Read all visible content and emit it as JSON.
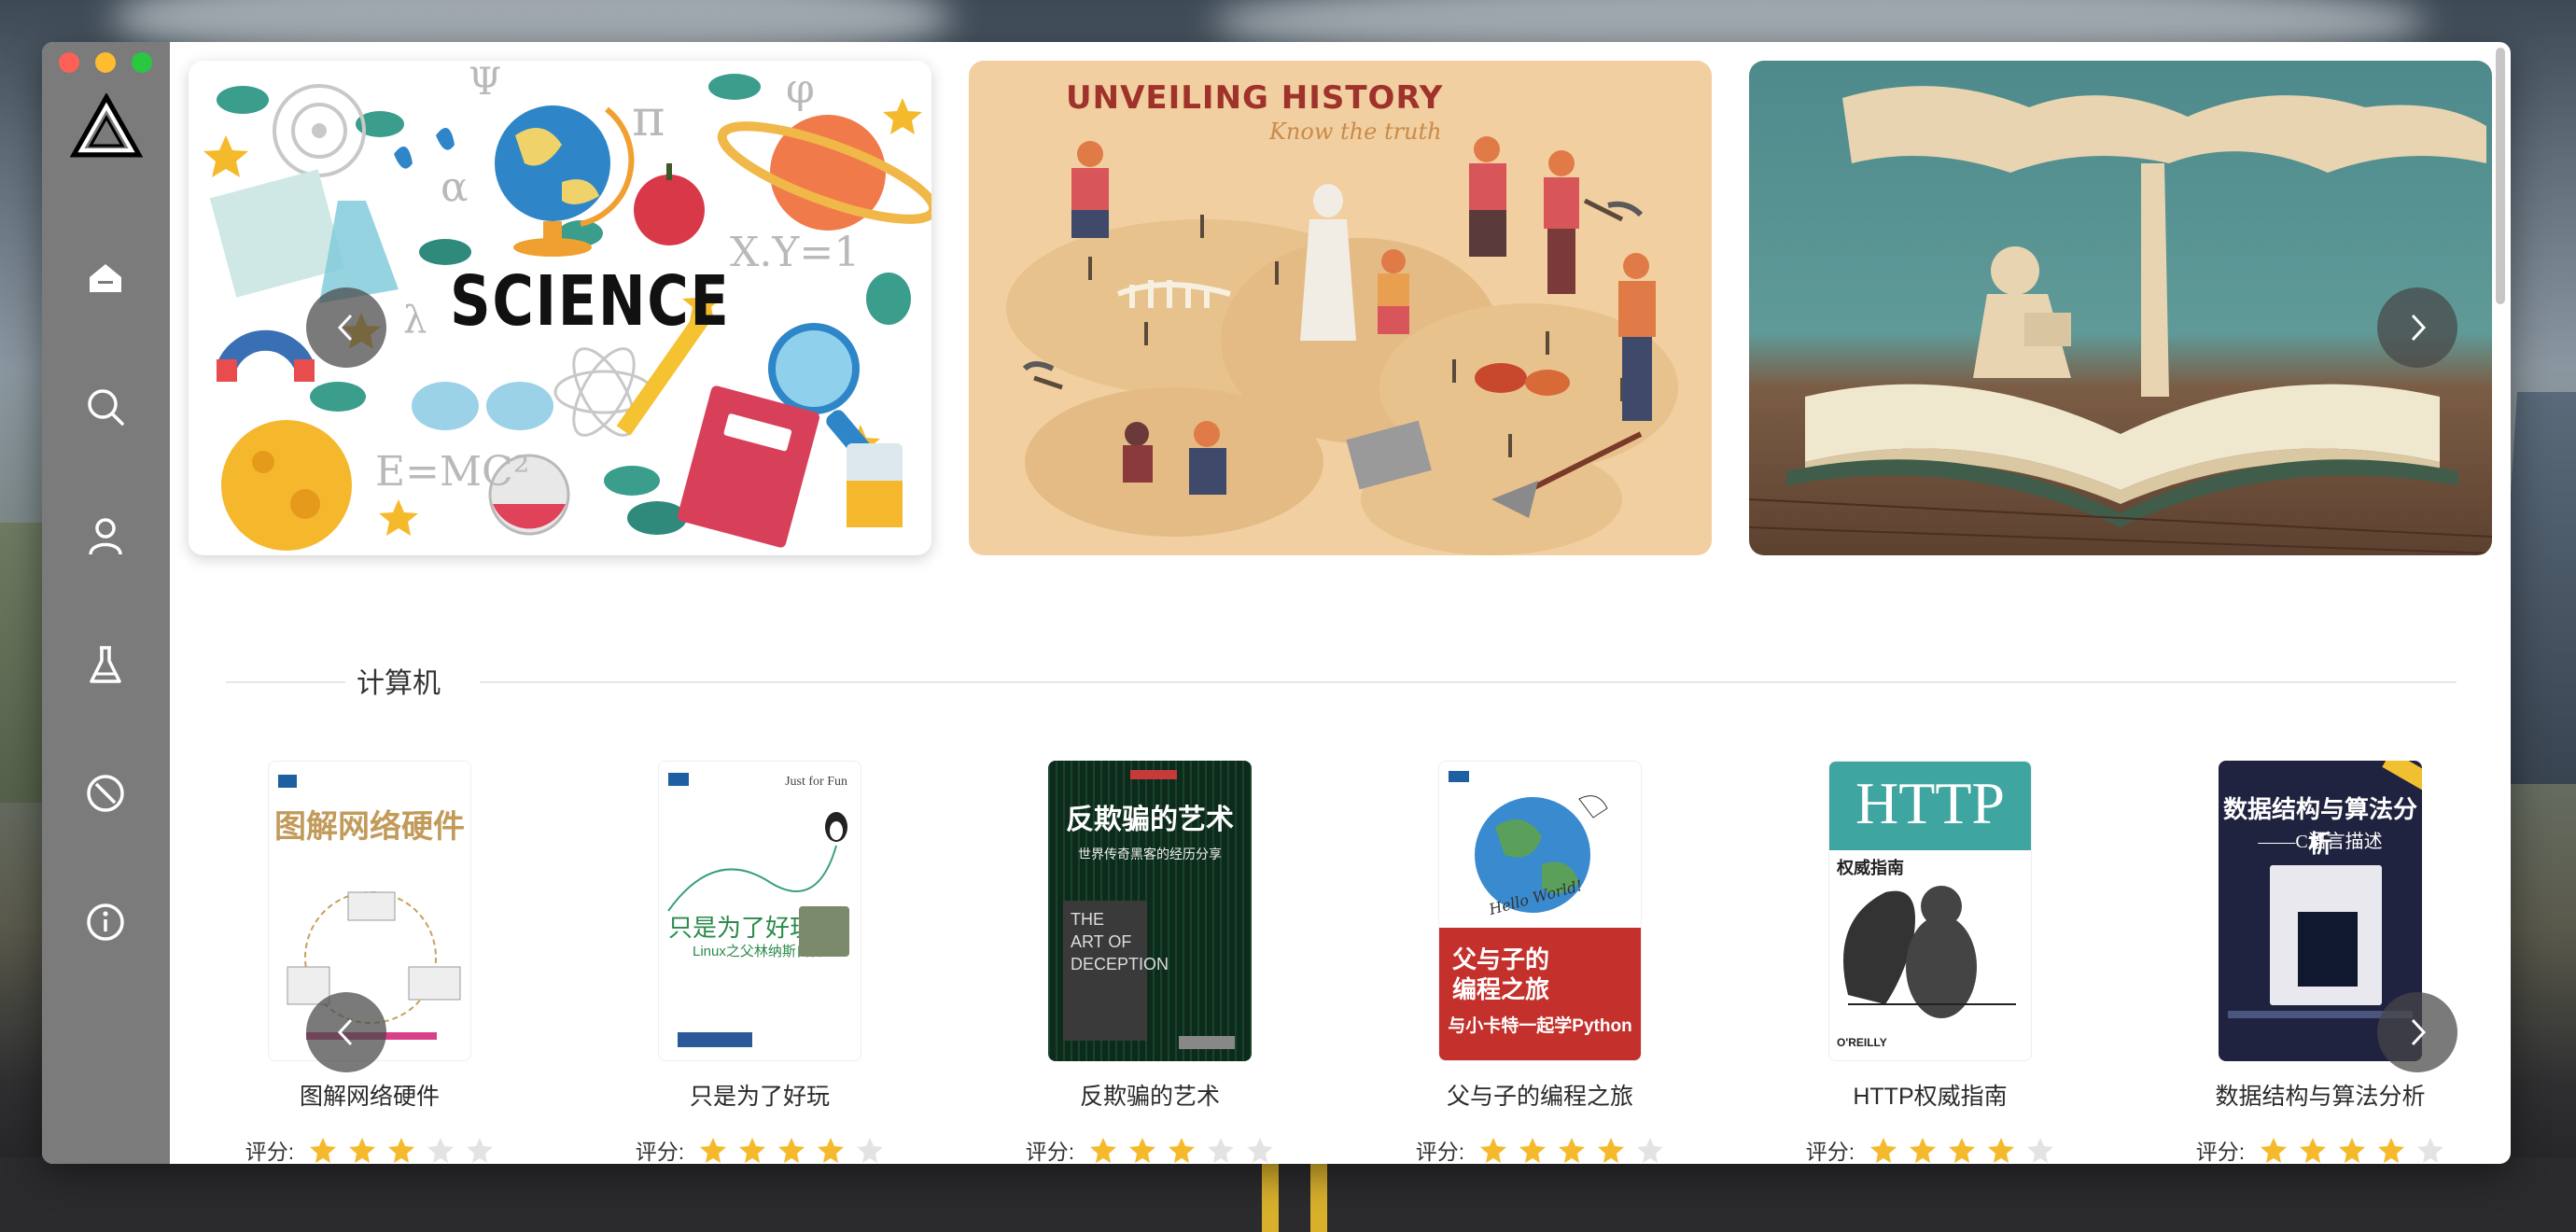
{
  "window": {
    "controls": [
      "close",
      "minimize",
      "maximize"
    ]
  },
  "sidebar": {
    "logo": "triangle-logo",
    "items": [
      {
        "name": "home",
        "icon": "home-icon",
        "active": true
      },
      {
        "name": "search",
        "icon": "search-icon",
        "active": false
      },
      {
        "name": "user",
        "icon": "user-icon",
        "active": false
      },
      {
        "name": "lab",
        "icon": "flask-icon",
        "active": false
      },
      {
        "name": "blocked",
        "icon": "ban-icon",
        "active": false
      },
      {
        "name": "about",
        "icon": "info-icon",
        "active": false
      }
    ]
  },
  "banners": [
    {
      "name": "science",
      "text": "SCIENCE",
      "formulas": [
        "E=MC²",
        "X.Y=1",
        "λ",
        "π",
        "α",
        "φ",
        "Ψ"
      ]
    },
    {
      "name": "history",
      "title": "UNVEILING HISTORY",
      "subtitle": "Know the truth"
    },
    {
      "name": "reading",
      "text": ""
    }
  ],
  "section": {
    "title": "计算机"
  },
  "books": [
    {
      "title": "图解网络硬件",
      "cover_title": "图解网络硬件",
      "rating": 3,
      "max_rating": 5,
      "cover_color": "#ffffff"
    },
    {
      "title": "只是为了好玩",
      "cover_title": "只是为了好玩",
      "cover_sub": "Linux之父林纳斯自传",
      "cover_tag": "Just for Fun",
      "rating": 4,
      "max_rating": 5,
      "cover_color": "#ffffff"
    },
    {
      "title": "反欺骗的艺术",
      "cover_title": "反欺骗的艺术",
      "cover_sub": "世界传奇黑客的经历分享",
      "cover_en": "THE ART OF DECEPTION",
      "rating": 3,
      "max_rating": 5,
      "cover_color": "#0e2a1c"
    },
    {
      "title": "父与子的编程之旅",
      "cover_title": "父与子的编程之旅",
      "cover_sub": "与小卡特一起学Python",
      "cover_en": "Hello World!",
      "rating": 4,
      "max_rating": 5,
      "cover_color": "#c4302b"
    },
    {
      "title": "HTTP权威指南",
      "cover_title": "HTTP",
      "cover_sub": "权威指南",
      "cover_publisher": "O'REILLY",
      "rating": 4,
      "max_rating": 5,
      "cover_color": "#3fa5a0"
    },
    {
      "title": "数据结构与算法分析",
      "cover_title": "数据结构与算法分析",
      "cover_sub": "——C语言描述",
      "rating": 4,
      "max_rating": 5,
      "cover_color": "#1f2340"
    }
  ],
  "rating_label": "评分:",
  "colors": {
    "sidebar": "#7b7b7b",
    "star_filled": "#f5b92c",
    "star_empty": "#e3e3e3",
    "accent_red": "#a0322c"
  }
}
